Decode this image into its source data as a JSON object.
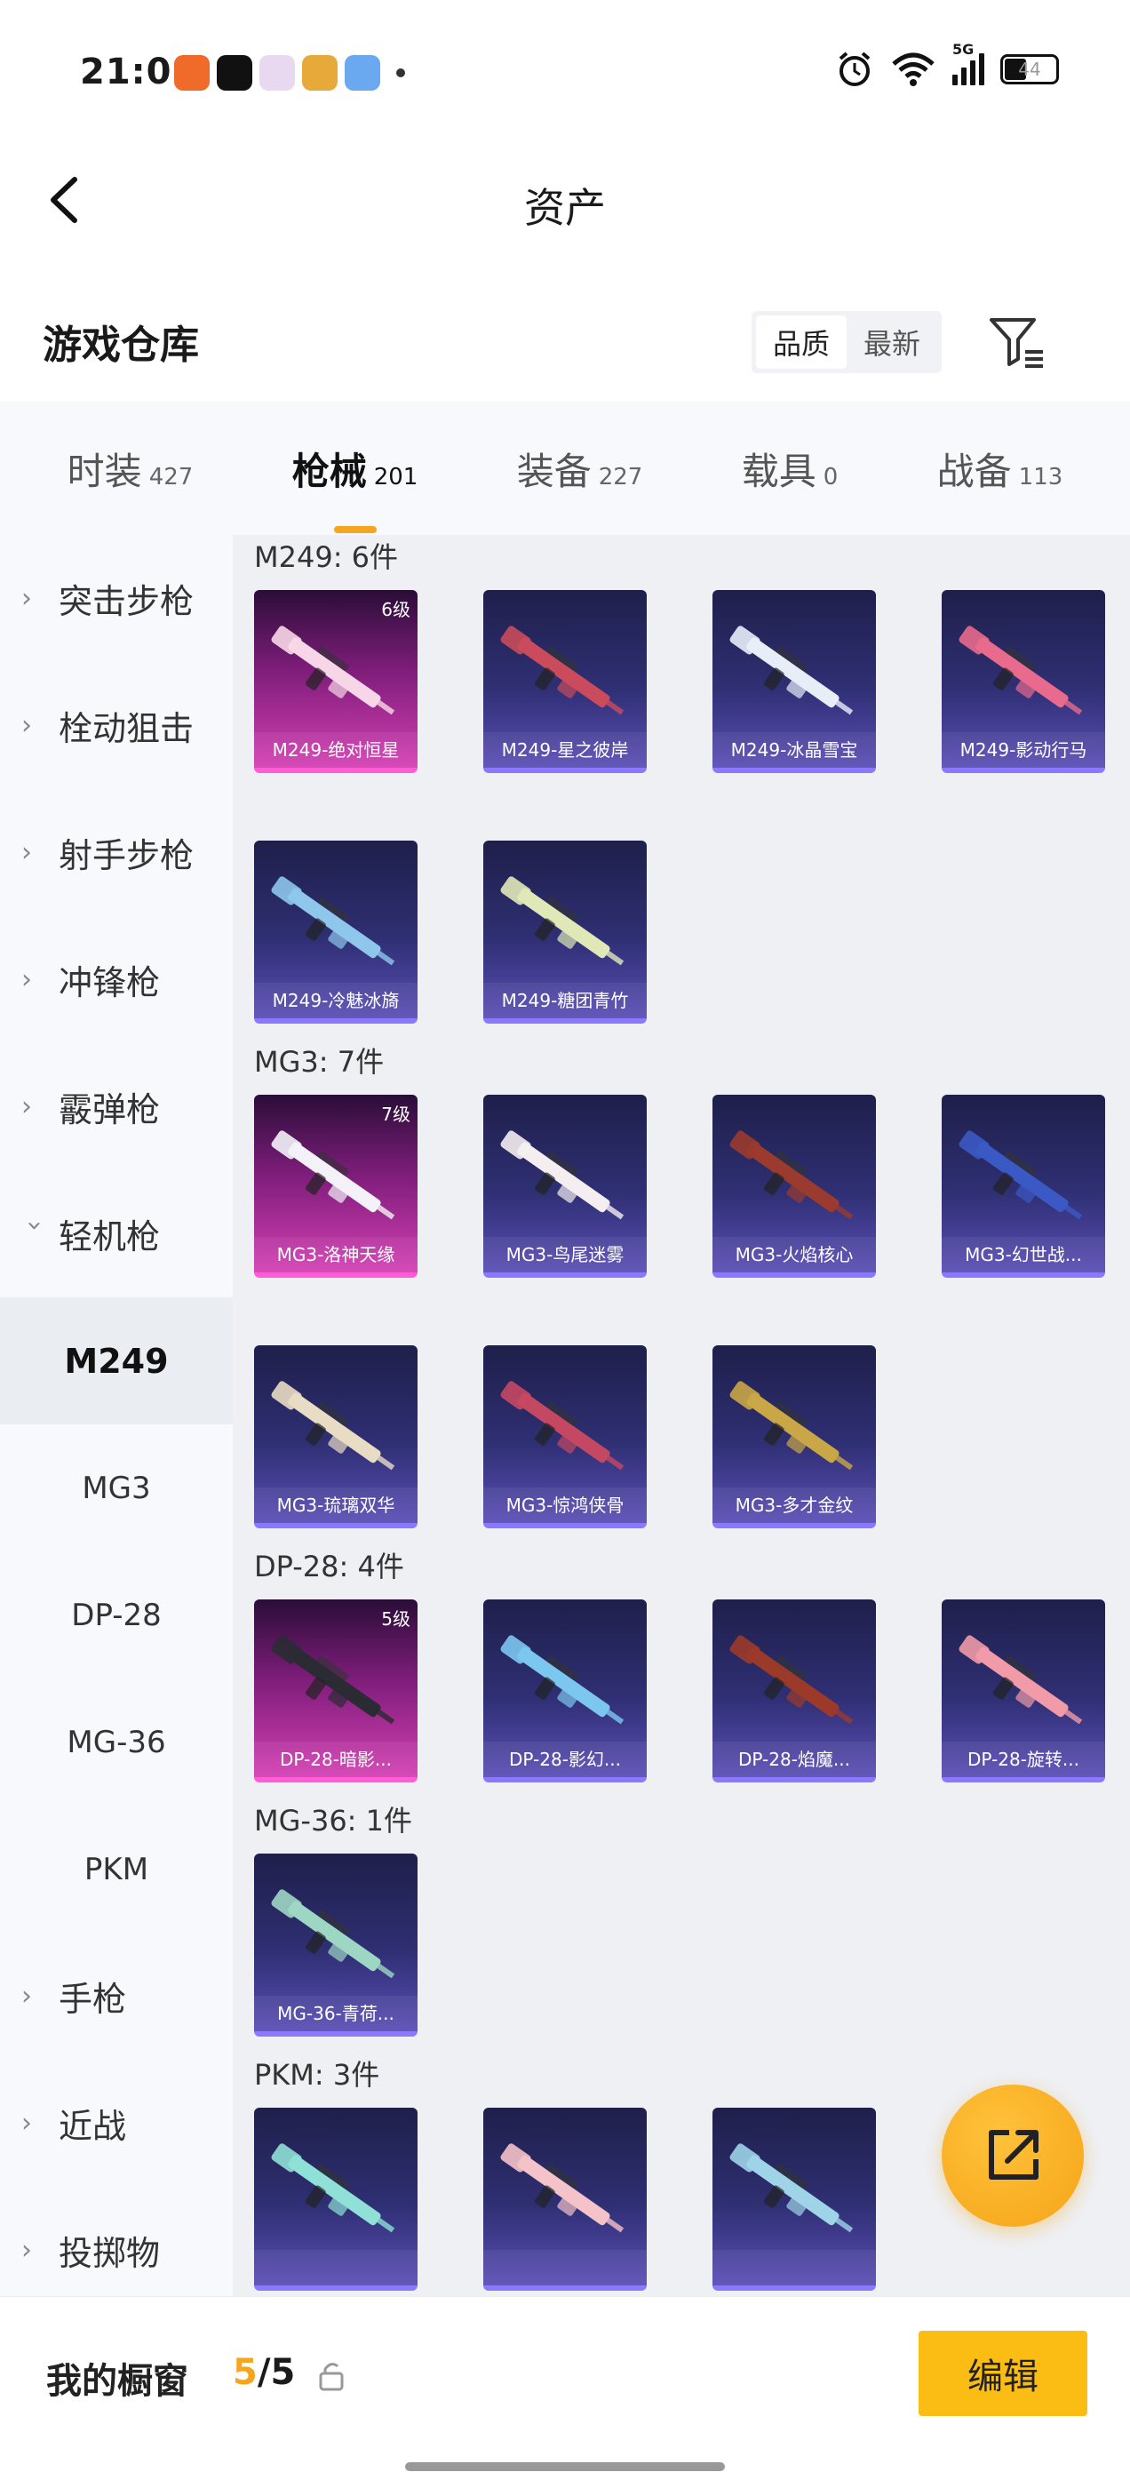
{
  "status_bar": {
    "time": "21:06",
    "network": "5G",
    "battery": "44"
  },
  "header": {
    "title": "资产"
  },
  "toolbar": {
    "warehouse_title": "游戏仓库",
    "sort_options": [
      "品质",
      "最新"
    ],
    "active_sort": "品质"
  },
  "tabs": [
    {
      "label": "时装",
      "count": "427"
    },
    {
      "label": "枪械",
      "count": "201",
      "active": true
    },
    {
      "label": "装备",
      "count": "227"
    },
    {
      "label": "载具",
      "count": "0"
    },
    {
      "label": "战备",
      "count": "113"
    }
  ],
  "sidebar": {
    "items": [
      {
        "label": "突击步枪"
      },
      {
        "label": "栓动狙击"
      },
      {
        "label": "射手步枪"
      },
      {
        "label": "冲锋枪"
      },
      {
        "label": "霰弹枪"
      },
      {
        "label": "轻机枪",
        "expanded": true
      }
    ],
    "sub_items": [
      "M249",
      "MG3",
      "DP-28",
      "MG-36",
      "PKM"
    ],
    "active_sub": "M249",
    "items_after": [
      {
        "label": "手枪"
      },
      {
        "label": "近战"
      },
      {
        "label": "投掷物"
      }
    ]
  },
  "groups": [
    {
      "label": "M249: 6件",
      "items": [
        {
          "name": "M249-绝对恒星",
          "grade": "6级",
          "rarity": "mythic",
          "color": "#f7d7e7"
        },
        {
          "name": "M249-星之彼岸",
          "rarity": "legendary",
          "color": "#c94b5c"
        },
        {
          "name": "M249-冰晶雪宝",
          "rarity": "legendary",
          "color": "#e8eef8"
        },
        {
          "name": "M249-影动行马",
          "rarity": "legendary",
          "color": "#e86a8c"
        },
        {
          "name": "M249-冷魅冰旖",
          "rarity": "legendary",
          "color": "#8ec6ec"
        },
        {
          "name": "M249-糖团青竹",
          "rarity": "legendary",
          "color": "#e0e8b8"
        }
      ]
    },
    {
      "label": "MG3: 7件",
      "items": [
        {
          "name": "MG3-洛神天缘",
          "grade": "7级",
          "rarity": "mythic",
          "color": "#f2f2f8"
        },
        {
          "name": "MG3-鸟尾迷雾",
          "rarity": "legendary",
          "color": "#f4eef0"
        },
        {
          "name": "MG3-火焰核心",
          "rarity": "legendary",
          "color": "#9b3a2e"
        },
        {
          "name": "MG3-幻世战...",
          "rarity": "legendary",
          "color": "#3b59c4"
        },
        {
          "name": "MG3-琉璃双华",
          "rarity": "legendary",
          "color": "#e9dcc4"
        },
        {
          "name": "MG3-惊鸿侠骨",
          "rarity": "legendary",
          "color": "#c54863"
        },
        {
          "name": "MG3-多才金纹",
          "rarity": "legendary",
          "color": "#c9a646"
        }
      ]
    },
    {
      "label": "DP-28: 4件",
      "items": [
        {
          "name": "DP-28-暗影...",
          "grade": "5级",
          "rarity": "mythic",
          "color": "#2b2b33"
        },
        {
          "name": "DP-28-影幻...",
          "rarity": "legendary",
          "color": "#7cc7f0"
        },
        {
          "name": "DP-28-焰魔...",
          "rarity": "legendary",
          "color": "#9c3a2a"
        },
        {
          "name": "DP-28-旋转...",
          "rarity": "legendary",
          "color": "#f19aa8"
        }
      ]
    },
    {
      "label": "MG-36: 1件",
      "items": [
        {
          "name": "MG-36-青荷...",
          "rarity": "legendary",
          "color": "#9ed6c4"
        }
      ]
    },
    {
      "label": "PKM: 3件",
      "items": [
        {
          "name": "",
          "rarity": "legendary",
          "color": "#8fe0d6"
        },
        {
          "name": "",
          "rarity": "legendary",
          "color": "#f4c2c9"
        },
        {
          "name": "",
          "rarity": "legendary",
          "color": "#9fd4e8"
        }
      ]
    }
  ],
  "bottom_bar": {
    "showcase_label": "我的橱窗",
    "showcase_current": "5",
    "showcase_total": "/5",
    "edit_label": "编辑"
  },
  "colors": {
    "accent": "#f6a61e",
    "edit_button": "#fbbd13"
  },
  "icons": {
    "back": "chevron-left-icon",
    "filter": "filter-icon",
    "share": "share-external-icon",
    "lock": "lock-icon"
  }
}
